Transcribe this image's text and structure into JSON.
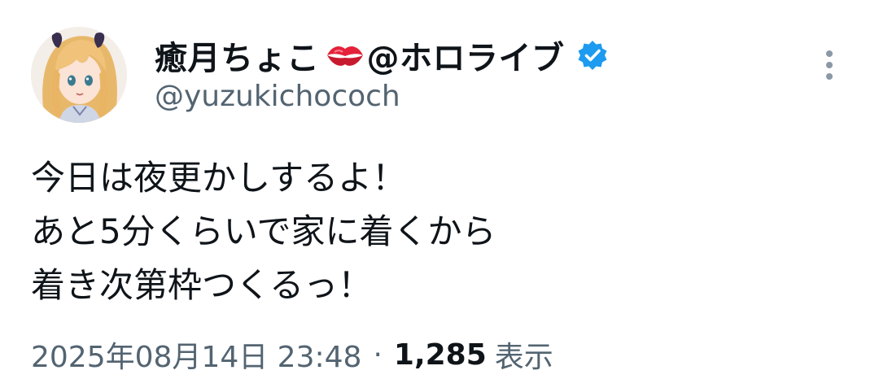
{
  "author": {
    "display_name": "癒月ちょこ",
    "display_name_suffix": "@ホロライブ",
    "name_emoji": "kiss-mark-icon",
    "verified_badge": "verified-badge-icon",
    "verified_color": "#1d9bf0",
    "handle": "@yuzukichococh",
    "avatar": "avatar-image"
  },
  "menu": {
    "more_icon": "more-vertical-icon"
  },
  "tweet": {
    "lines": [
      "今日は夜更かしするよ！",
      "あと5分くらいで家に着くから",
      "着き次第枠つくるっ！"
    ]
  },
  "meta": {
    "datetime": "2025年08月14日 23:48",
    "separator": "·",
    "views_count": "1,285",
    "views_label": "表示"
  },
  "colors": {
    "text_primary": "#0f1419",
    "text_secondary": "#536471",
    "background": "#ffffff",
    "accent": "#1d9bf0"
  }
}
